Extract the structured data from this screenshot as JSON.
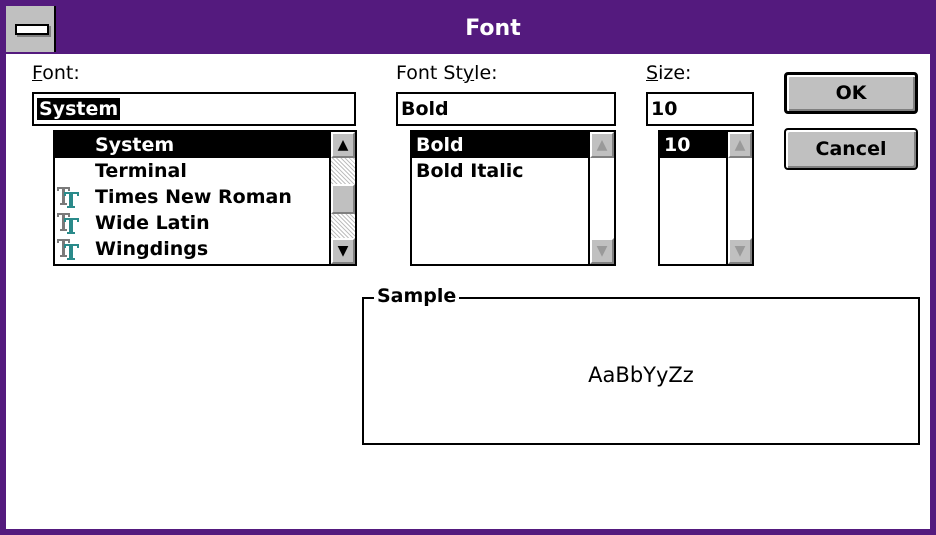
{
  "window": {
    "title": "Font"
  },
  "font": {
    "label_hot": "F",
    "label_rest": "ont:",
    "value": "System",
    "items": [
      {
        "name": "System",
        "truetype": false,
        "selected": true
      },
      {
        "name": "Terminal",
        "truetype": false,
        "selected": false
      },
      {
        "name": "Times New Roman",
        "truetype": true,
        "selected": false
      },
      {
        "name": "Wide Latin",
        "truetype": true,
        "selected": false
      },
      {
        "name": "Wingdings",
        "truetype": true,
        "selected": false
      }
    ]
  },
  "style": {
    "label_pre": "Font St",
    "label_hot": "y",
    "label_rest": "le:",
    "value": "Bold",
    "items": [
      {
        "name": "Bold",
        "selected": true
      },
      {
        "name": "Bold Italic",
        "selected": false
      }
    ]
  },
  "size": {
    "label_hot": "S",
    "label_rest": "ize:",
    "value": "10",
    "items": [
      {
        "name": "10",
        "selected": true
      }
    ]
  },
  "buttons": {
    "ok": "OK",
    "cancel": "Cancel"
  },
  "sample": {
    "label": "Sample",
    "text": "AaBbYyZz"
  },
  "icons": {
    "system_menu": "system-menu-icon",
    "truetype": "truetype-icon",
    "scroll_up": "scroll-up-arrow-icon",
    "scroll_down": "scroll-down-arrow-icon"
  },
  "colors": {
    "title_bar": "#541a7e",
    "truetype_icon": "#2a8a8a"
  }
}
